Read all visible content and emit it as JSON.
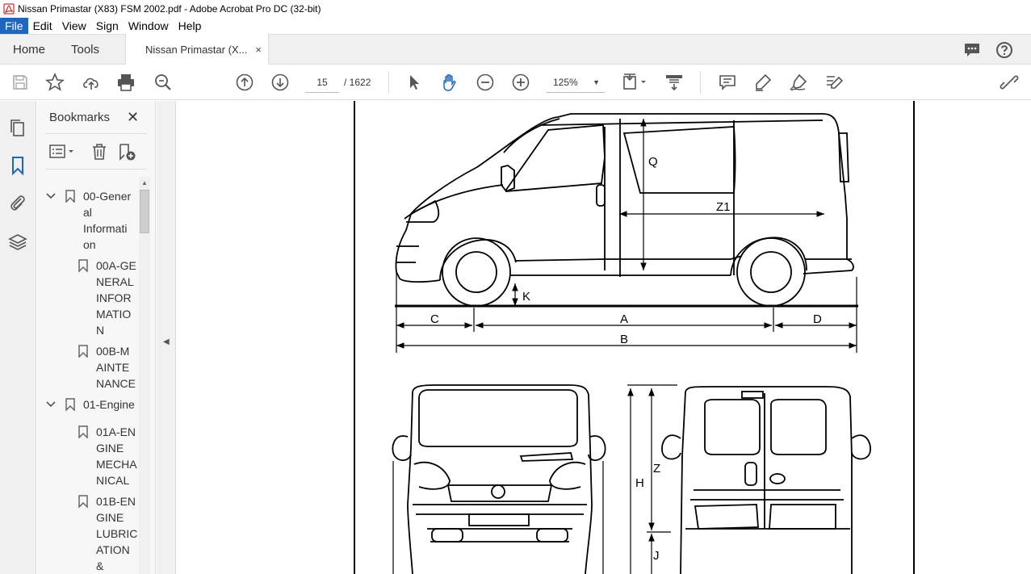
{
  "window": {
    "title": "Nissan Primastar (X83) FSM 2002.pdf - Adobe Acrobat Pro DC (32-bit)"
  },
  "menu": [
    "File",
    "Edit",
    "View",
    "Sign",
    "Window",
    "Help"
  ],
  "tabs": {
    "home": "Home",
    "tools": "Tools",
    "document": "Nissan Primastar (X...",
    "close": "×"
  },
  "toolbar": {
    "page_current": "15",
    "page_total": "/ 1622",
    "zoom": "125%",
    "zoom_caret": "▼"
  },
  "bookmarks": {
    "title": "Bookmarks",
    "close": "✕",
    "items": [
      {
        "label": "00-General Information",
        "lines": [
          "00-Gener",
          "al",
          "Informati",
          "on"
        ],
        "level": 0,
        "expanded": true
      },
      {
        "label": "00A-GENERAL INFORMATION",
        "lines": [
          "00A-GE",
          "NERAL",
          "INFOR",
          "MATIO",
          "N"
        ],
        "level": 1
      },
      {
        "label": "00B-MAINTENANCE",
        "lines": [
          "00B-M",
          "AINTE",
          "NANCE"
        ],
        "level": 1
      },
      {
        "label": "01-Engine",
        "lines": [
          "01-Engine"
        ],
        "level": 0,
        "expanded": true
      },
      {
        "label": "01A-ENGINE MECHANICAL",
        "lines": [
          "01A-EN",
          "GINE",
          "MECHA",
          "NICAL"
        ],
        "level": 1
      },
      {
        "label": "01B-ENGINE LUBRICATION &",
        "lines": [
          "01B-EN",
          "GINE",
          "LUBRIC",
          "ATION",
          "&"
        ],
        "level": 1
      }
    ]
  },
  "diagram": {
    "labels": {
      "Q": "Q",
      "Z1": "Z1",
      "K": "K",
      "C": "C",
      "A": "A",
      "D": "D",
      "B": "B",
      "H": "H",
      "Z": "Z",
      "J": "J"
    }
  }
}
